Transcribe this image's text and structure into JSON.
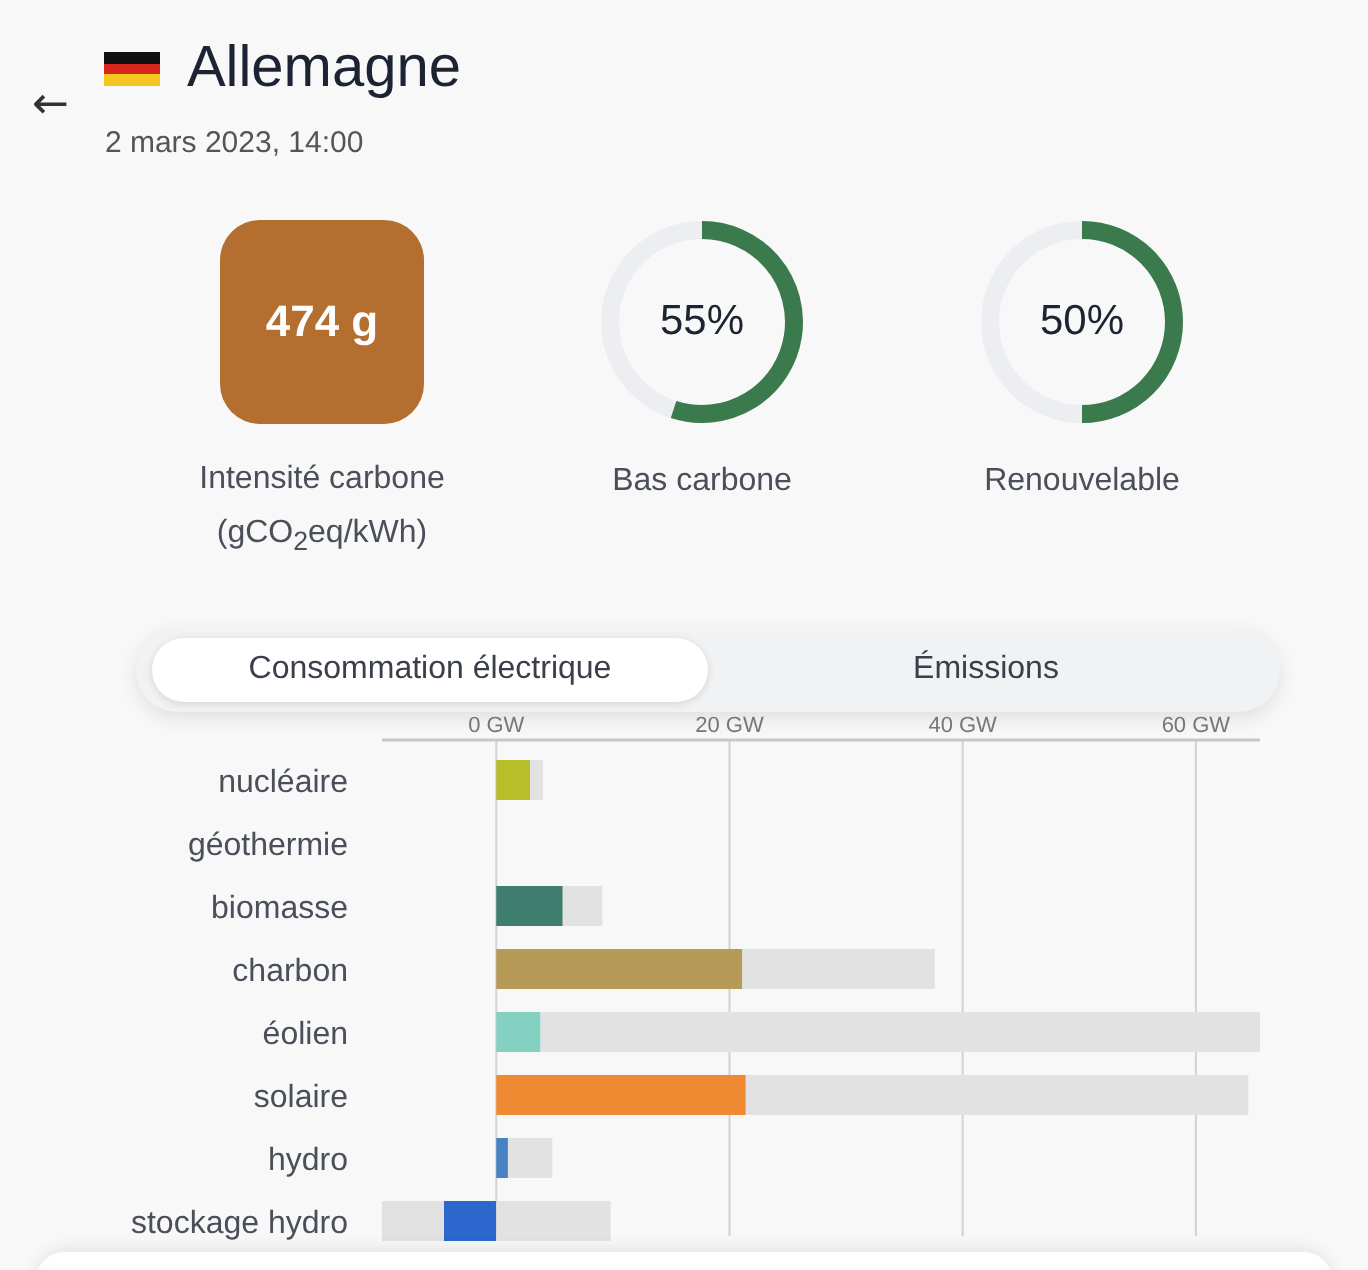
{
  "header": {
    "back_label": "←",
    "title": "Allemagne",
    "date": "2 mars 2023, 14:00"
  },
  "metrics": [
    {
      "kind": "intensity",
      "value": "474 g",
      "label": "Intensité carbone",
      "sublabel": "(gCO$_{2}$eq/kWh)",
      "color": "#b46e30"
    },
    {
      "kind": "ring",
      "value": "55%",
      "label": "Bas carbone",
      "level": 0.55
    },
    {
      "kind": "ring",
      "value": "50%",
      "label": "Renouvelable",
      "level": 0.5
    }
  ],
  "tabs": [
    {
      "label": "Consommation électrique",
      "selected": true
    },
    {
      "label": "Émissions",
      "selected": false
    }
  ],
  "chart_data": {
    "type": "bar",
    "orientation": "horizontal",
    "stacked": true,
    "grid": true,
    "categories": [
      "nucléaire",
      "géothermie",
      "biomasse",
      "charbon",
      "éolien",
      "solaire",
      "hydro",
      "stockage hydro"
    ],
    "xticks": [
      {
        "value": 0,
        "label": "0 GW"
      },
      {
        "value": 20,
        "label": "20 GW"
      },
      {
        "value": 40,
        "label": "40 GW"
      },
      {
        "value": 60,
        "label": "60 GW"
      }
    ],
    "xlim": [
      -9.8,
      65.5
    ],
    "series": [
      {
        "color": "#b8be2a",
        "values": [
          2.9,
          null,
          null,
          null,
          null,
          null,
          null,
          null
        ]
      },
      {
        "color": "#3f7d6e",
        "values": [
          null,
          null,
          5.7,
          null,
          null,
          null,
          null,
          null
        ]
      },
      {
        "color": "#b59a58",
        "values": [
          null,
          null,
          null,
          21.1,
          null,
          null,
          null,
          null
        ]
      },
      {
        "color": "#84d1c1",
        "values": [
          null,
          null,
          null,
          null,
          3.8,
          null,
          null,
          null
        ]
      },
      {
        "color": "#ef8a33",
        "values": [
          null,
          null,
          null,
          null,
          null,
          21.4,
          null,
          null
        ]
      },
      {
        "color": "#4682bf",
        "values": [
          null,
          null,
          null,
          null,
          null,
          null,
          1.0,
          null
        ]
      },
      {
        "color": "#2b67cc",
        "values": [
          null,
          null,
          null,
          null,
          null,
          null,
          null,
          -4.5
        ]
      },
      {
        "color": "#e2e2e2",
        "values": [
          1.1,
          null,
          3.4,
          16.5,
          61.7,
          43.1,
          3.8,
          9.8
        ]
      },
      {
        "color": "#e1e1e1",
        "values": [
          null,
          null,
          null,
          null,
          null,
          null,
          null,
          -5.3
        ]
      }
    ]
  }
}
